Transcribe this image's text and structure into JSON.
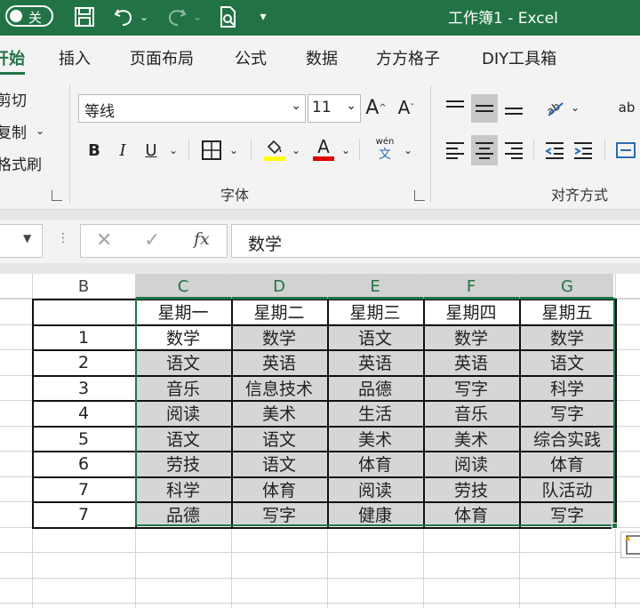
{
  "titlebar": {
    "autosave_label": "关",
    "title": "工作簿1 - Excel"
  },
  "menu": {
    "tabs": [
      "开始",
      "插入",
      "页面布局",
      "公式",
      "数据",
      "方方格子",
      "DIY工具箱"
    ]
  },
  "ribbon": {
    "clipboard": {
      "cut": "剪切",
      "copy": "复制",
      "format_painter": "格式刷"
    },
    "font": {
      "name": "等线",
      "size": "11",
      "bold": "B",
      "italic": "I",
      "underline": "U",
      "grow": "A",
      "shrink": "A",
      "font_color_letter": "A",
      "phonetic_top": "wén",
      "phonetic_bottom": "文",
      "group_label": "字体"
    },
    "alignment": {
      "group_label": "对齐方式",
      "wrap_text": "ab"
    },
    "colors": {
      "highlight": "#ffff00",
      "font_color": "#e00000"
    }
  },
  "formula_bar": {
    "fx": "fx",
    "content": "数学"
  },
  "sheet": {
    "col_headers": [
      "B",
      "C",
      "D",
      "E",
      "F",
      "G"
    ],
    "row_numbers": [
      "1",
      "2",
      "3",
      "4",
      "5",
      "6",
      "7",
      "7"
    ],
    "weekdays": [
      "星期一",
      "星期二",
      "星期三",
      "星期四",
      "星期五"
    ],
    "rows": [
      [
        "数学",
        "数学",
        "语文",
        "数学",
        "数学"
      ],
      [
        "语文",
        "英语",
        "英语",
        "英语",
        "语文"
      ],
      [
        "音乐",
        "信息技术",
        "品德",
        "写字",
        "科学"
      ],
      [
        "阅读",
        "美术",
        "生活",
        "音乐",
        "写字"
      ],
      [
        "语文",
        "语文",
        "美术",
        "美术",
        "综合实践"
      ],
      [
        "劳技",
        "语文",
        "体育",
        "阅读",
        "体育"
      ],
      [
        "科学",
        "体育",
        "阅读",
        "劳技",
        "队活动"
      ],
      [
        "品德",
        "写字",
        "健康",
        "体育",
        "写字"
      ]
    ]
  }
}
